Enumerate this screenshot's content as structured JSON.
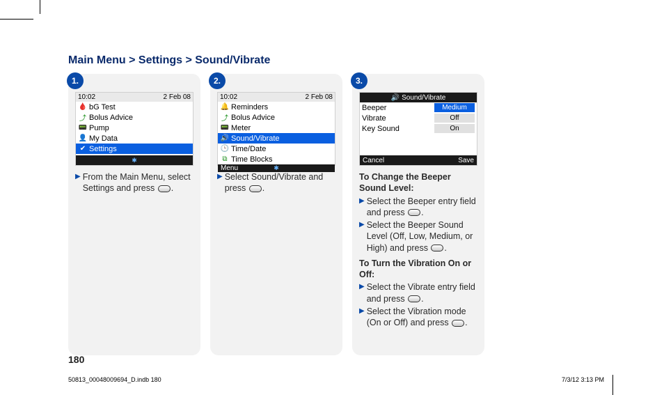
{
  "breadcrumb": "Main Menu > Settings > Sound/Vibrate",
  "page_number": "180",
  "footer": {
    "left": "50813_00048009694_D.indb   180",
    "right": "7/3/12   3:13 PM"
  },
  "cards": [
    {
      "badge": "1.",
      "status": {
        "time": "10:02",
        "date": "2 Feb 08"
      },
      "menu": [
        {
          "icon": "🩸",
          "iconColor": "#c00",
          "label": "bG Test",
          "selected": false
        },
        {
          "icon": "⤴",
          "iconColor": "#1a8f1a",
          "label": "Bolus Advice",
          "selected": false
        },
        {
          "icon": "📟",
          "iconColor": "#1673d6",
          "label": "Pump",
          "selected": false
        },
        {
          "icon": "👤",
          "iconColor": "#777",
          "label": "My Data",
          "selected": false
        },
        {
          "icon": "✔",
          "iconColor": "#1a8f1a",
          "label": "Settings",
          "selected": true
        }
      ],
      "footerbar": {
        "center_icon": "✱"
      },
      "instruction_lines": [
        "From the Main Menu, select Settings and press {btn}."
      ]
    },
    {
      "badge": "2.",
      "status": {
        "time": "10:02",
        "date": "2 Feb 08"
      },
      "menu": [
        {
          "icon": "🔔",
          "iconColor": "#e6b800",
          "label": "Reminders",
          "selected": false
        },
        {
          "icon": "⤴",
          "iconColor": "#1a8f1a",
          "label": "Bolus Advice",
          "selected": false
        },
        {
          "icon": "📟",
          "iconColor": "#1673d6",
          "label": "Meter",
          "selected": false
        },
        {
          "icon": "🔊",
          "iconColor": "#1673d6",
          "label": "Sound/Vibrate",
          "selected": true
        },
        {
          "icon": "🕒",
          "iconColor": "#1a8f1a",
          "label": "Time/Date",
          "selected": false
        },
        {
          "icon": "⧉",
          "iconColor": "#1a8f1a",
          "label": "Time Blocks",
          "selected": false
        }
      ],
      "footerbar": {
        "left": "Menu",
        "center_icon": "✱"
      },
      "instruction_lines": [
        "Select Sound/Vibrate and press {btn}."
      ]
    },
    {
      "badge": "3.",
      "titlebar": {
        "icon": "🔊",
        "label": "Sound/Vibrate"
      },
      "options": [
        {
          "key": "Beeper",
          "value": "Medium",
          "selected": true
        },
        {
          "key": "Vibrate",
          "value": "Off",
          "selected": false
        },
        {
          "key": "Key Sound",
          "value": "On",
          "selected": false
        }
      ],
      "footerbar": {
        "left": "Cancel",
        "right": "Save"
      },
      "sections": [
        {
          "heading": "To Change the Beeper Sound Level:",
          "bullets": [
            "Select the Beeper entry field and press {btn}.",
            "Select the Beeper Sound Level (Off, Low, Medium, or High) and press {btn}."
          ]
        },
        {
          "heading": "To Turn the Vibration On or Off:",
          "bullets": [
            "Select the Vibrate entry field and press {btn}.",
            "Select the Vibration mode (On or Off) and press {btn}."
          ]
        }
      ]
    }
  ]
}
